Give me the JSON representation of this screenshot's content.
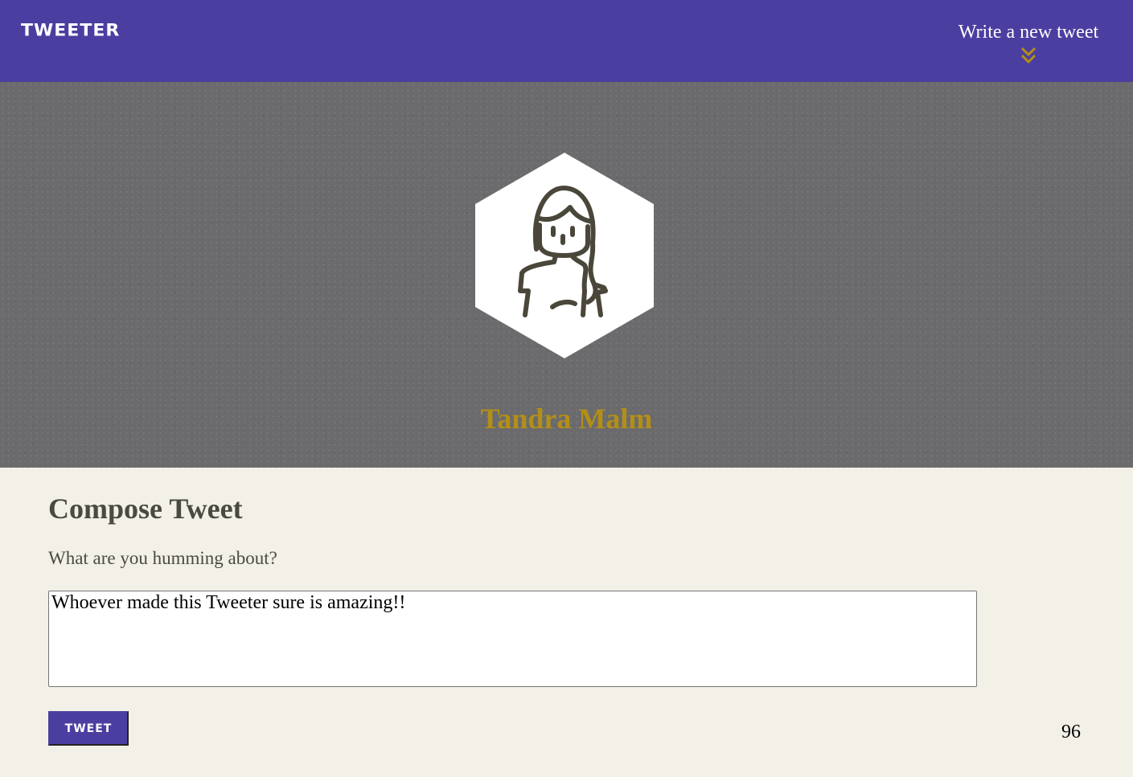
{
  "nav": {
    "logo": "TWEETER",
    "compose_label": "Write a new tweet",
    "compose_icon": "double-chevron-down-icon"
  },
  "profile": {
    "name": "Tandra Malm",
    "avatar_icon": "woman-avatar-icon"
  },
  "compose": {
    "title": "Compose Tweet",
    "label": "What are you humming about?",
    "text_value": "Whoever made this Tweeter sure is amazing!!",
    "button_label": "TWEET",
    "counter": "96"
  },
  "colors": {
    "nav": "#4a3fa0",
    "accent": "#b38f16",
    "header_bg": "#6b6b6d",
    "page_bg": "#f3f0e8"
  }
}
